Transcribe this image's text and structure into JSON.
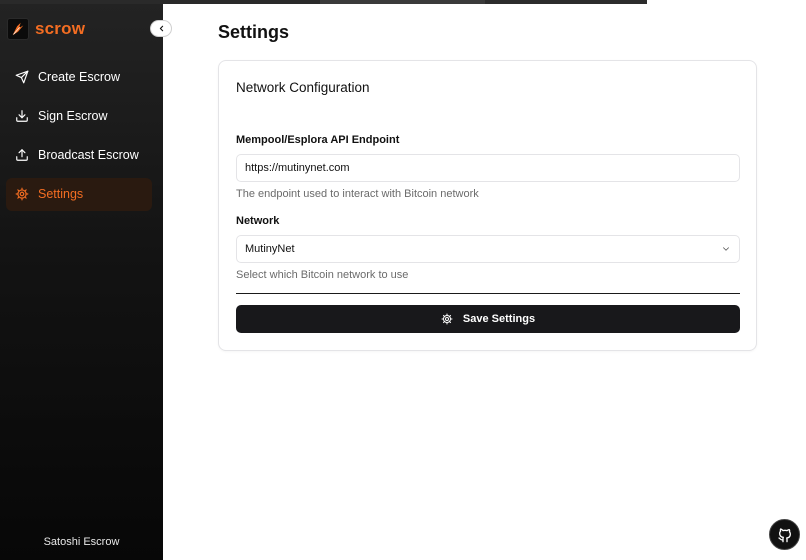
{
  "brand": {
    "name": "scrow",
    "accent": "#f36d22"
  },
  "sidebar": {
    "items": [
      {
        "label": "Create Escrow",
        "icon": "send-icon",
        "active": false
      },
      {
        "label": "Sign Escrow",
        "icon": "download-icon",
        "active": false
      },
      {
        "label": "Broadcast Escrow",
        "icon": "upload-icon",
        "active": false
      },
      {
        "label": "Settings",
        "icon": "gear-icon",
        "active": true
      }
    ],
    "footer": "Satoshi Escrow",
    "background": "#111111"
  },
  "page": {
    "title": "Settings"
  },
  "card": {
    "title": "Network Configuration",
    "endpoint": {
      "label": "Mempool/Esplora API Endpoint",
      "value": "https://mutinynet.com",
      "help": "The endpoint used to interact with Bitcoin network"
    },
    "network": {
      "label": "Network",
      "selected": "MutinyNet",
      "help": "Select which Bitcoin network to use"
    },
    "save_label": "Save Settings"
  },
  "icons": {
    "collapse": "chevron-left-icon",
    "github": "github-icon"
  }
}
